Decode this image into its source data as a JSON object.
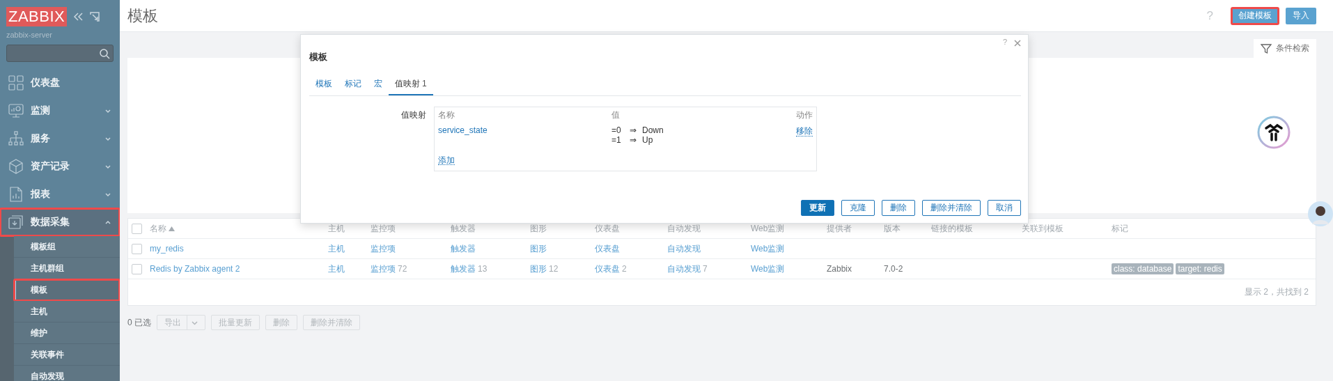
{
  "sidebar": {
    "logo": "ZABBIX",
    "server": "zabbix-server",
    "menu": [
      {
        "label": "仪表盘",
        "kind": "link",
        "expanded": false,
        "highlighted": false
      },
      {
        "label": "监测",
        "kind": "group",
        "expanded": false,
        "highlighted": false
      },
      {
        "label": "服务",
        "kind": "group",
        "expanded": false,
        "highlighted": false
      },
      {
        "label": "资产记录",
        "kind": "group",
        "expanded": false,
        "highlighted": false
      },
      {
        "label": "报表",
        "kind": "group",
        "expanded": false,
        "highlighted": false
      },
      {
        "label": "数据采集",
        "kind": "group",
        "expanded": true,
        "highlighted": true,
        "children": [
          {
            "label": "模板组",
            "selected": false,
            "highlighted": false
          },
          {
            "label": "主机群组",
            "selected": false,
            "highlighted": false
          },
          {
            "label": "模板",
            "selected": true,
            "highlighted": true
          },
          {
            "label": "主机",
            "selected": false,
            "highlighted": false
          },
          {
            "label": "维护",
            "selected": false,
            "highlighted": false
          },
          {
            "label": "关联事件",
            "selected": false,
            "highlighted": false
          },
          {
            "label": "自动发现",
            "selected": false,
            "highlighted": false
          }
        ]
      }
    ]
  },
  "header": {
    "title": "模板",
    "help": "?",
    "buttons": [
      {
        "label": "创建模板",
        "highlighted": true
      },
      {
        "label": "导入",
        "highlighted": false
      }
    ]
  },
  "filter": {
    "tab": "条件检索"
  },
  "table": {
    "select_all": false,
    "columns": [
      {
        "label": "名称",
        "sorted": true
      },
      {
        "label": "主机"
      },
      {
        "label": "监控项"
      },
      {
        "label": "触发器"
      },
      {
        "label": "图形"
      },
      {
        "label": "仪表盘"
      },
      {
        "label": "自动发现"
      },
      {
        "label": "Web监测"
      },
      {
        "label": "提供者"
      },
      {
        "label": "版本"
      },
      {
        "label": "链接的模板"
      },
      {
        "label": "关联到模板"
      },
      {
        "label": "标记"
      }
    ],
    "rows": [
      {
        "selected": false,
        "name": "my_redis",
        "links": [
          {
            "label": "主机"
          },
          {
            "label": "监控项"
          },
          {
            "label": "触发器"
          },
          {
            "label": "图形"
          },
          {
            "label": "仪表盘"
          },
          {
            "label": "自动发现"
          },
          {
            "label": "Web监测"
          }
        ]
      },
      {
        "selected": false,
        "name": "Redis by Zabbix agent 2",
        "links": [
          {
            "label": "主机"
          },
          {
            "label": "监控项",
            "count": "72"
          },
          {
            "label": "触发器",
            "count": "13"
          },
          {
            "label": "图形",
            "count": "12"
          },
          {
            "label": "仪表盘",
            "count": "2"
          },
          {
            "label": "自动发现",
            "count": "7"
          },
          {
            "label": "Web监测"
          }
        ],
        "provider": "Zabbix",
        "version": "7.0-2",
        "tags": [
          "class: database",
          "target: redis"
        ]
      }
    ],
    "footer": "显示 2，共找到 2"
  },
  "actions": {
    "selected": "0 已选",
    "buttons": [
      {
        "label": "导出",
        "dropdown": true,
        "disabled": true
      },
      {
        "label": "批量更新",
        "dropdown": false,
        "disabled": true
      },
      {
        "label": "删除",
        "dropdown": false,
        "disabled": true
      },
      {
        "label": "删除并清除",
        "dropdown": false,
        "disabled": true
      }
    ]
  },
  "modal": {
    "title": "模板",
    "help": "?",
    "tabs": [
      {
        "label": "模板",
        "selected": false
      },
      {
        "label": "标记",
        "selected": false
      },
      {
        "label": "宏",
        "selected": false
      },
      {
        "label": "值映射",
        "count": "1",
        "selected": true
      }
    ],
    "field_label": "值映射",
    "columns": [
      "名称",
      "值",
      "动作"
    ],
    "rows": [
      {
        "name": "service_state",
        "mappings": [
          {
            "value": "=0",
            "arrow": "⇒",
            "result": "Down"
          },
          {
            "value": "=1",
            "arrow": "⇒",
            "result": "Up"
          }
        ],
        "action": "移除"
      }
    ],
    "add": "添加",
    "buttons": [
      {
        "label": "更新",
        "kind": "primary"
      },
      {
        "label": "克隆",
        "kind": "secondary"
      },
      {
        "label": "删除",
        "kind": "secondary"
      },
      {
        "label": "删除并清除",
        "kind": "secondary"
      },
      {
        "label": "取消",
        "kind": "secondary"
      }
    ]
  }
}
